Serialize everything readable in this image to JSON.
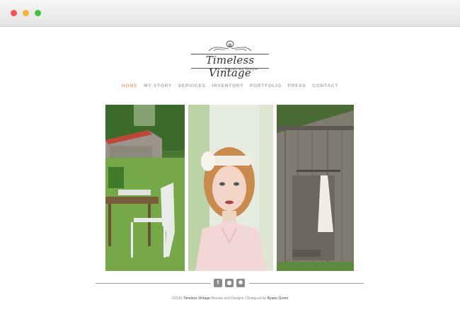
{
  "window": {
    "controls": [
      "close",
      "minimize",
      "maximize"
    ]
  },
  "logo": {
    "wordmark": "Timeless Vintage",
    "tagline": "Rentals and Designs"
  },
  "nav": {
    "items": [
      {
        "label": "HOME",
        "active": true
      },
      {
        "label": "MY STORY"
      },
      {
        "label": "SERVICES"
      },
      {
        "label": "INVENTORY"
      },
      {
        "label": "PORTFOLIO"
      },
      {
        "label": "PRESS"
      },
      {
        "label": "CONTACT"
      }
    ]
  },
  "gallery": [
    {
      "alt": "Barn with vintage table and chair"
    },
    {
      "alt": "Woman with vintage headband"
    },
    {
      "alt": "Dress hanging on old barn wall"
    }
  ],
  "social": [
    {
      "icon": "facebook-icon",
      "glyph": "f"
    },
    {
      "icon": "instagram-icon",
      "glyph": "◉"
    },
    {
      "icon": "yelp-icon",
      "glyph": "✱"
    }
  ],
  "footer": {
    "prefix": "©2015 ",
    "brand": "Timeless Vintage",
    "mid": " Rentals and Designs | Designed by ",
    "designer": "Ryann Green"
  },
  "colors": {
    "accent": "#f2a27a",
    "nav": "#a9a9a9",
    "footer_rule": "#999999"
  }
}
